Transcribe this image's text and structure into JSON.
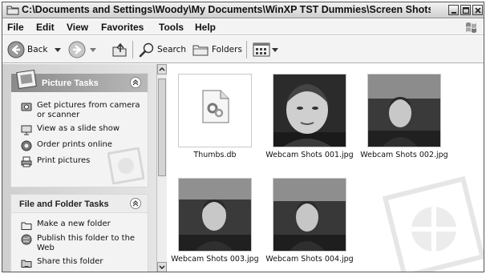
{
  "window": {
    "title": "C:\\Documents and Settings\\Woody\\My Documents\\WinXP TST Dummies\\Screen Shots\\C..."
  },
  "menu": [
    "File",
    "Edit",
    "View",
    "Favorites",
    "Tools",
    "Help"
  ],
  "toolbar": {
    "back_label": "Back",
    "search_label": "Search",
    "folders_label": "Folders"
  },
  "picture_tasks": {
    "title": "Picture Tasks",
    "items": [
      "Get pictures from camera or scanner",
      "View as a slide show",
      "Order prints online",
      "Print pictures"
    ]
  },
  "file_folder_tasks": {
    "title": "File and Folder Tasks",
    "items": [
      "Make a new folder",
      "Publish this folder to the Web",
      "Share this folder"
    ]
  },
  "files": [
    {
      "name": "Thumbs.db",
      "kind": "system-file-icon"
    },
    {
      "name": "Webcam Shots 001.jpg",
      "kind": "photo"
    },
    {
      "name": "Webcam Shots 002.jpg",
      "kind": "photo"
    },
    {
      "name": "Webcam Shots 003.jpg",
      "kind": "photo"
    },
    {
      "name": "Webcam Shots 004.jpg",
      "kind": "photo"
    }
  ],
  "icons": [
    "folder-icon",
    "back-arrow-icon",
    "forward-arrow-icon",
    "up-folder-icon",
    "search-icon",
    "folders-icon",
    "views-icon",
    "windows-logo-icon",
    "camera-icon",
    "slideshow-icon",
    "order-prints-icon",
    "print-icon",
    "new-folder-icon",
    "globe-icon",
    "share-icon",
    "collapse-chevron-icon"
  ]
}
